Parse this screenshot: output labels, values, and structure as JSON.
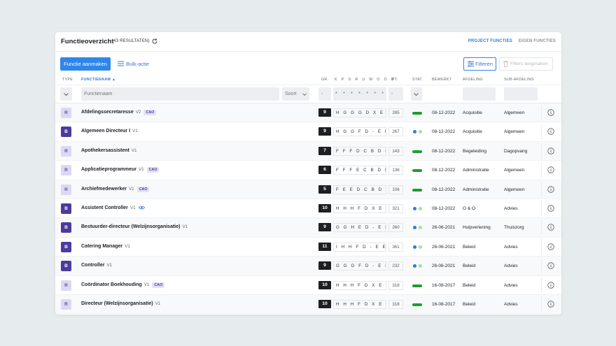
{
  "header": {
    "title": "Functieoverzicht",
    "count": "(43 RESULTATEN)"
  },
  "tabs": [
    {
      "label": "PROJECT FUNCTIES",
      "active": true
    },
    {
      "label": "EIGEN FUNCTIES",
      "active": false
    }
  ],
  "toolbar": {
    "add_label": "Functie aanmaken",
    "bulk_label": "Bulk-actie",
    "filter_label": "Filteren",
    "clear_label": "Filters leegmaken"
  },
  "columns": {
    "type": "TYPE",
    "name": "FUNCTIENAAM",
    "gr": "GR.",
    "codes": "K P S R U M O O B",
    "pt": "PT.",
    "stat": "STAT.",
    "edited": "BEWERKT",
    "dept": "AFDELING",
    "subdept": "SUB-AFDELING"
  },
  "filters": {
    "name_placeholder": "Functienaam",
    "sort_label": "Soort",
    "dash": "-",
    "stars": "* * * * * * * * *"
  },
  "rows": [
    {
      "type": "R",
      "name": "Afdelingssecretaresse",
      "ver": "V2",
      "cao": "CAO",
      "gr": "9",
      "codes": "H G G G D X E E X",
      "pt": "285",
      "stat": "bar",
      "date": "08-12-2022",
      "dept": "Acquisitie",
      "sub": "Algemeen"
    },
    {
      "type": "B",
      "name": "Algemeen Directeur I",
      "ver": "V1",
      "cao": "",
      "gr": "9",
      "codes": "H G G F D - E E -",
      "pt": "267",
      "stat": "dots",
      "date": "08-12-2022",
      "dept": "Acquisitie",
      "sub": "Algemeen"
    },
    {
      "type": "R",
      "name": "Apothekersassistent",
      "ver": "V1",
      "cao": "",
      "gr": "7",
      "codes": "F F F D C B D C D",
      "pt": "143",
      "stat": "bar",
      "date": "08-12-2022",
      "dept": "Begeleiding",
      "sub": "Dagopvang"
    },
    {
      "type": "R",
      "name": "Applicatieprogrammeur",
      "ver": "V1",
      "cao": "CAO",
      "gr": "6",
      "codes": "F F F E C B D D X",
      "pt": "136",
      "stat": "bar",
      "date": "08-12-2022",
      "dept": "Administratie",
      "sub": "Algemeen"
    },
    {
      "type": "R",
      "name": "Archiefmedewerker",
      "ver": "V1",
      "cao": "CAO",
      "gr": "5",
      "codes": "F E E D C B D X",
      "pt": "106",
      "stat": "bar",
      "date": "08-12-2022",
      "dept": "Administratie",
      "sub": "Algemeen"
    },
    {
      "type": "B",
      "name": "Assistent Controller",
      "ver": "V1",
      "cao": "",
      "eye": true,
      "gr": "10",
      "codes": "H H H F D X E E X",
      "pt": "321",
      "stat": "dots",
      "date": "08-12-2022",
      "dept": "O & O",
      "sub": "Advies"
    },
    {
      "type": "B",
      "name": "Bestuurder-directeur (Welzijnsorganisatie)",
      "ver": "V1",
      "cao": "",
      "gr": "9",
      "codes": "G G H E D - E E B",
      "pt": "260",
      "stat": "dots",
      "date": "26-06-2021",
      "dept": "Hulpverlening",
      "sub": "Thuiszorg"
    },
    {
      "type": "B",
      "name": "Catering Manager",
      "ver": "V1",
      "cao": "",
      "gr": "11",
      "codes": "I H H F D - E E -",
      "pt": "361",
      "stat": "dots",
      "date": "26-06-2021",
      "dept": "Beleid",
      "sub": "Advies"
    },
    {
      "type": "B",
      "name": "Controller",
      "ver": "V1",
      "cao": "",
      "gr": "9",
      "codes": "G G G F D - E D -",
      "pt": "232",
      "stat": "dots",
      "date": "26-06-2021",
      "dept": "Beleid",
      "sub": "Advies"
    },
    {
      "type": "R",
      "name": "Coördinator Boekhouding",
      "ver": "V1",
      "cao": "CAO",
      "gr": "10",
      "codes": "H H H F D X E E X",
      "pt": "318",
      "stat": "bar",
      "date": "16-08-2017",
      "dept": "Beleid",
      "sub": "Advies"
    },
    {
      "type": "R",
      "name": "Directeur (Welzijnsorganisatie)",
      "ver": "V1",
      "cao": "",
      "gr": "10",
      "codes": "H H H F D X E E X",
      "pt": "318",
      "stat": "bar",
      "date": "16-08-2017",
      "dept": "Beleid",
      "sub": "Advies"
    }
  ]
}
